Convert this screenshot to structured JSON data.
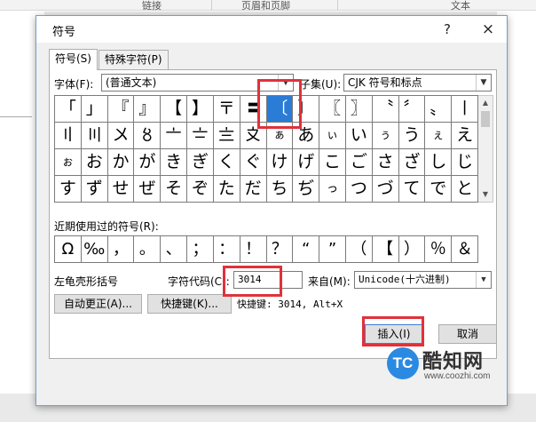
{
  "ribbon": {
    "items": [
      "链接",
      "页眉和页脚",
      "文本"
    ]
  },
  "dialog": {
    "title": "符号",
    "help": "?",
    "close": "×",
    "tabs": [
      {
        "label": "符号(S)",
        "active": true
      },
      {
        "label": "特殊字符(P)",
        "active": false
      }
    ],
    "font_label": "字体(F):",
    "font_value": "(普通文本)",
    "subset_label": "子集(U):",
    "subset_value": "CJK 符号和标点",
    "grid": [
      [
        "「",
        "」",
        "『",
        "』",
        "【",
        "】",
        "〒",
        "〓",
        "〔",
        "〕",
        "〖",
        "〗",
        "〝",
        "〞",
        "〟",
        "〡"
      ],
      [
        "〢",
        "〣",
        "〤",
        "〥",
        "〦",
        "〧",
        "〨",
        "〩",
        "ぁ",
        "あ",
        "ぃ",
        "い",
        "ぅ",
        "う",
        "ぇ",
        "え"
      ],
      [
        "ぉ",
        "お",
        "か",
        "が",
        "き",
        "ぎ",
        "く",
        "ぐ",
        "け",
        "げ",
        "こ",
        "ご",
        "さ",
        "ざ",
        "し",
        "じ"
      ],
      [
        "す",
        "ず",
        "せ",
        "ぜ",
        "そ",
        "ぞ",
        "た",
        "だ",
        "ち",
        "ぢ",
        "っ",
        "つ",
        "づ",
        "て",
        "で",
        "と"
      ]
    ],
    "selected": {
      "row": 0,
      "col": 8
    },
    "recent_label": "近期使用过的符号(R):",
    "recent": [
      "Ω",
      "‰",
      "，",
      "。",
      "、",
      "；",
      "：",
      "！",
      "？",
      "“",
      "”",
      "（",
      "【",
      "）",
      "％",
      "＆"
    ],
    "char_name": "左龟壳形括号",
    "code_label": "字符代码(C):",
    "code_value": "3014",
    "from_label": "来自(M):",
    "from_value": "Unicode(十六进制)",
    "autocorrect": "自动更正(A)...",
    "shortcut_key": "快捷键(K)...",
    "shortcut_text": "快捷键: 3014, Alt+X",
    "insert": "插入(I)",
    "cancel": "取消"
  },
  "watermark": {
    "logo_text": "TC",
    "name": "酷知网",
    "url": "www.coozhi.com"
  },
  "colors": {
    "highlight": "#e0313a",
    "selection": "#2a7cd6",
    "accent": "#3c7fd1"
  }
}
